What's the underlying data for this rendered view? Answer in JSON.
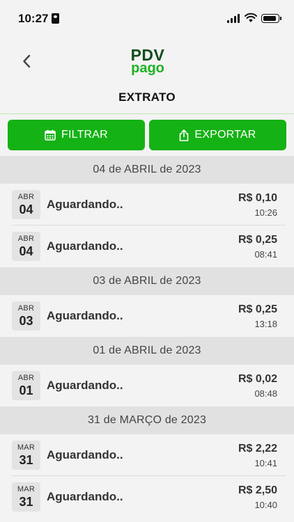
{
  "status_bar": {
    "time": "10:27"
  },
  "header": {
    "logo_top": "PDV",
    "logo_bottom": "pago",
    "title": "EXTRATO"
  },
  "actions": {
    "filter_label": "FILTRAR",
    "export_label": "EXPORTAR"
  },
  "groups": [
    {
      "date": "04 de ABRIL de 2023",
      "items": [
        {
          "month": "ABR",
          "day": "04",
          "status": "Aguardando..",
          "amount": "R$ 0,10",
          "time": "10:26"
        },
        {
          "month": "ABR",
          "day": "04",
          "status": "Aguardando..",
          "amount": "R$ 0,25",
          "time": "08:41"
        }
      ]
    },
    {
      "date": "03 de ABRIL de 2023",
      "items": [
        {
          "month": "ABR",
          "day": "03",
          "status": "Aguardando..",
          "amount": "R$ 0,25",
          "time": "13:18"
        }
      ]
    },
    {
      "date": "01 de ABRIL de 2023",
      "items": [
        {
          "month": "ABR",
          "day": "01",
          "status": "Aguardando..",
          "amount": "R$ 0,02",
          "time": "08:48"
        }
      ]
    },
    {
      "date": "31 de MARÇO de 2023",
      "items": [
        {
          "month": "MAR",
          "day": "31",
          "status": "Aguardando..",
          "amount": "R$ 2,22",
          "time": "10:41"
        },
        {
          "month": "MAR",
          "day": "31",
          "status": "Aguardando..",
          "amount": "R$ 2,50",
          "time": "10:40"
        }
      ]
    }
  ],
  "colors": {
    "brand_green": "#15b215",
    "logo_dark_green": "#134d1a",
    "logo_light_green": "#1cb321",
    "date_header_bg": "#e1e1e1"
  }
}
